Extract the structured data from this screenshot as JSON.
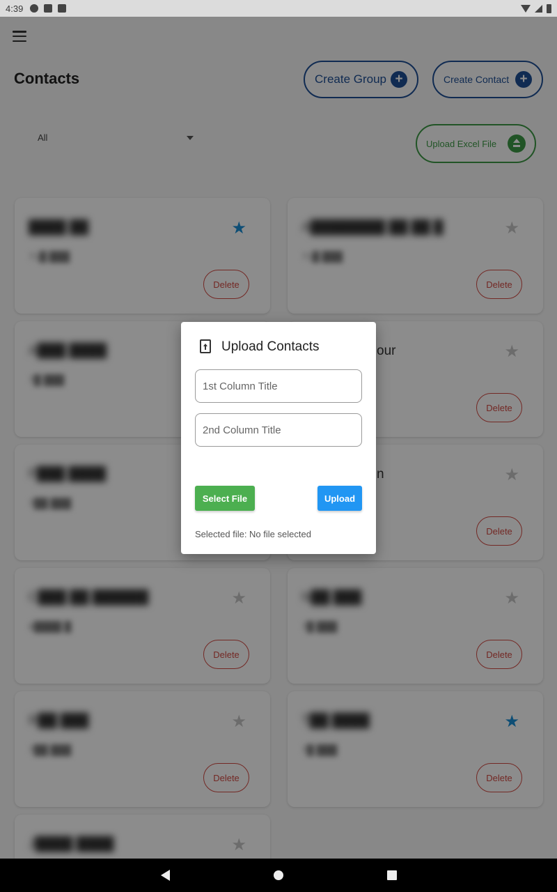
{
  "status_bar": {
    "time": "4:39"
  },
  "app_bar": {
    "title": "Contacts"
  },
  "actions": {
    "create_group": "Create Group",
    "create_contact": "Create Contact",
    "upload_excel": "Upload Excel File"
  },
  "filter": {
    "selected": "All"
  },
  "contacts": [
    {
      "name": "████ ██",
      "phone": "71█ ███",
      "favorite": true,
      "delete_label": "Delete"
    },
    {
      "name": "A████████ ██ ██ █",
      "phone": "71█ ███",
      "favorite": false,
      "delete_label": "Delete"
    },
    {
      "name": "A███ ████",
      "phone": "7█ ███",
      "favorite": false,
      "delete_label": "Delete"
    },
    {
      "name": "our",
      "phone": "",
      "favorite": false,
      "delete_label": "Delete"
    },
    {
      "name": "F███ ████",
      "phone": "7██ ███",
      "favorite": false,
      "delete_label": "Delete"
    },
    {
      "name": "n",
      "phone": "",
      "favorite": false,
      "delete_label": "Delete"
    },
    {
      "name": "C███ ██ ██████",
      "phone": "6████ █",
      "favorite": false,
      "delete_label": "Delete"
    },
    {
      "name": "N██ ███",
      "phone": "7█ ███",
      "favorite": false,
      "delete_label": "Delete"
    },
    {
      "name": "R██ ███",
      "phone": "7██ ███",
      "favorite": false,
      "delete_label": "Delete"
    },
    {
      "name": "T██ ████",
      "phone": "7█ ███",
      "favorite": true,
      "delete_label": "Delete"
    },
    {
      "name": "J████ ████",
      "phone": "",
      "favorite": false,
      "delete_label": ""
    }
  ],
  "dialog": {
    "title": "Upload Contacts",
    "field1_placeholder": "1st Column Title",
    "field2_placeholder": "2nd Column Title",
    "select_file_label": "Select File",
    "upload_label": "Upload",
    "selected_file_text": "Selected file: No file selected"
  },
  "colors": {
    "primary_blue": "#1e4f96",
    "excel_green": "#3d9a45",
    "star_favorite": "#1a8fd6",
    "delete_red": "#d24a43",
    "select_button": "#4caf50",
    "upload_button": "#2196f3"
  }
}
